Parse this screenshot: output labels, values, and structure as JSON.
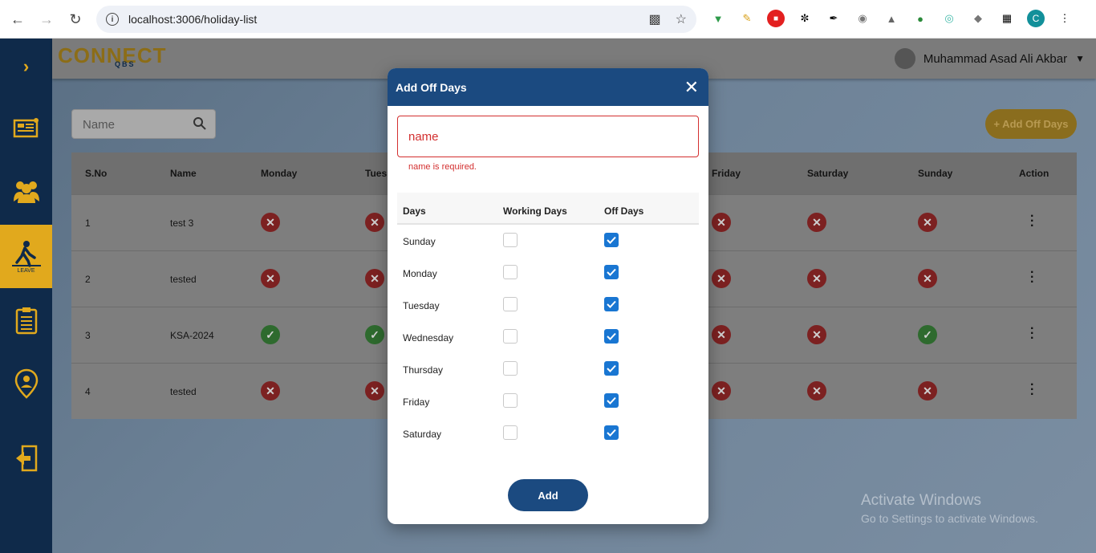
{
  "browser": {
    "url": "localhost:3006/holiday-list",
    "profile_initial": "C"
  },
  "app": {
    "logo_text": "CONNECT",
    "logo_sub": "QBS",
    "user_name": "Muhammad Asad Ali Akbar",
    "search_placeholder": "Name",
    "add_button_label": "+ Add Off Days",
    "sidebar_active_label": "LEAVE"
  },
  "table": {
    "headers": [
      "S.No",
      "Name",
      "Monday",
      "Tues",
      "Friday",
      "Saturday",
      "Sunday",
      "Action"
    ],
    "rows": [
      {
        "sno": "1",
        "name": "test 3",
        "monday": "x",
        "tuesday": "x",
        "friday": "x",
        "saturday": "x",
        "sunday": "x"
      },
      {
        "sno": "2",
        "name": "tested",
        "monday": "x",
        "tuesday": "x",
        "friday": "x",
        "saturday": "x",
        "sunday": "x"
      },
      {
        "sno": "3",
        "name": "KSA-2024",
        "monday": "ok",
        "tuesday": "ok",
        "friday": "x",
        "saturday": "x",
        "sunday": "ok"
      },
      {
        "sno": "4",
        "name": "tested",
        "monday": "x",
        "tuesday": "x",
        "friday": "x",
        "saturday": "x",
        "sunday": "x"
      }
    ]
  },
  "watermark": {
    "line1": "Activate Windows",
    "line2": "Go to Settings to activate Windows."
  },
  "modal": {
    "title": "Add Off Days",
    "name_placeholder": "name",
    "name_error": "name is required.",
    "col_days": "Days",
    "col_working": "Working Days",
    "col_off": "Off Days",
    "days": [
      {
        "label": "Sunday",
        "working": false,
        "off": true
      },
      {
        "label": "Monday",
        "working": false,
        "off": true
      },
      {
        "label": "Tuesday",
        "working": false,
        "off": true
      },
      {
        "label": "Wednesday",
        "working": false,
        "off": true
      },
      {
        "label": "Thursday",
        "working": false,
        "off": true
      },
      {
        "label": "Friday",
        "working": false,
        "off": true
      },
      {
        "label": "Saturday",
        "working": false,
        "off": true
      }
    ],
    "submit_label": "Add"
  }
}
